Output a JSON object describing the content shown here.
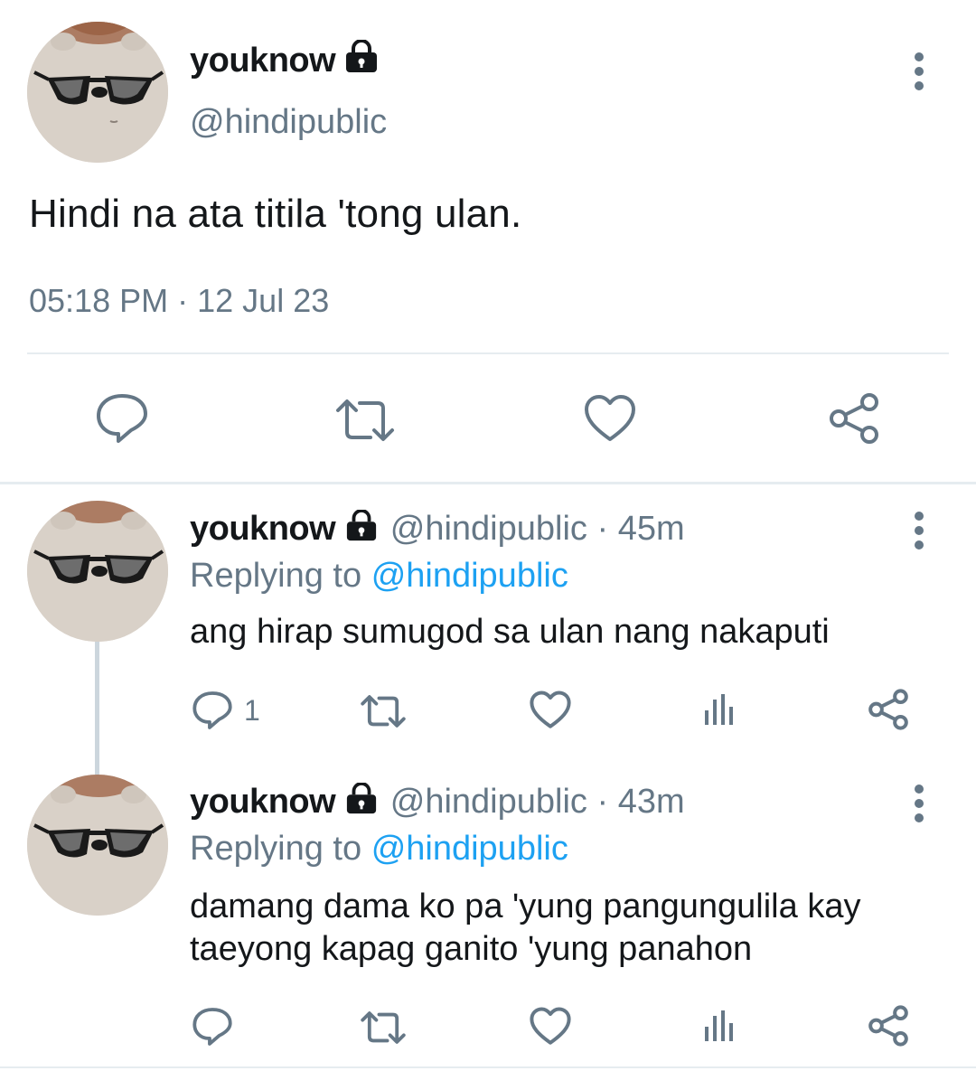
{
  "main_tweet": {
    "display_name": "youknow",
    "handle": "@hindipublic",
    "text": "Hindi na ata titila 'tong ulan.",
    "time": "05:18 PM",
    "separator": "·",
    "date": "12 Jul 23",
    "actions": [
      "reply-icon",
      "retweet-icon",
      "like-icon",
      "share-icon"
    ]
  },
  "replies": [
    {
      "display_name": "youknow",
      "handle": "@hindipublic",
      "separator": "·",
      "age": "45m",
      "replying_label": "Replying to",
      "replying_to": "@hindipublic",
      "text": "ang hirap sumugod sa ulan nang nakaputi",
      "reply_count": "1"
    },
    {
      "display_name": "youknow",
      "handle": "@hindipublic",
      "separator": "·",
      "age": "43m",
      "replying_label": "Replying to",
      "replying_to": "@hindipublic",
      "text_line1": "damang dama ko pa 'yung pangungulila kay",
      "text_line2": "taeyong kapag ganito 'yung panahon",
      "reply_count": ""
    }
  ],
  "colors": {
    "text": "#14171a",
    "secondary": "#657786",
    "mention": "#1da1f2",
    "divider": "#e6ecf0"
  }
}
